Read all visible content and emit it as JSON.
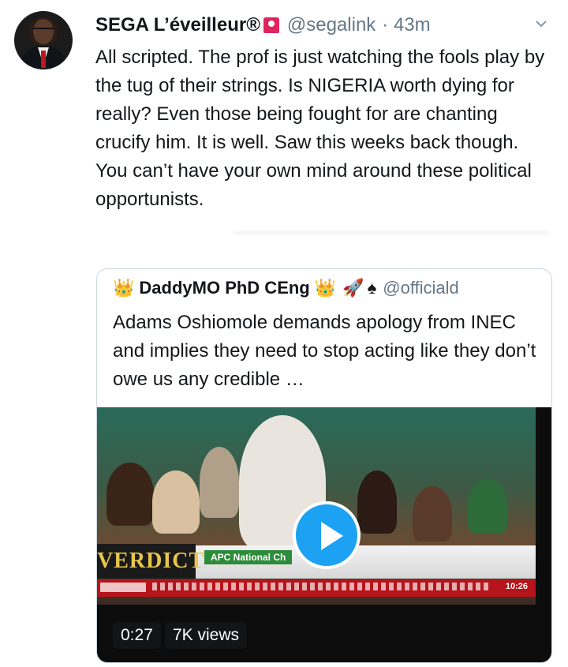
{
  "tweet": {
    "author_name": "SEGA L’éveilleur®",
    "author_handle": "@segalink",
    "timestamp": "· 43m",
    "text": "All scripted. The prof is just watching the fools play by the tug of their strings. Is NIGERIA worth dying for really? Even those being fought for are chanting crucify him. It is well. Saw this weeks back though. You can’t have your own mind around these political opportunists.",
    "siren_icon": "police-light-emoji",
    "menu_icon": "chevron-down-icon"
  },
  "quoted": {
    "crown_left": "👑",
    "author_name": "DaddyMO PhD CEng",
    "crown_right": "👑",
    "rocket": "🚀",
    "spade": "♠",
    "author_handle": "@officiald",
    "text": "Adams Oshiomole demands apology from INEC and implies they need to stop acting like they don’t owe us any credible …",
    "video": {
      "duration": "0:27",
      "views": "7K views",
      "banner_logo": "VERDICT",
      "banner_tag": "APC National Ch",
      "clock": "10:26",
      "accent_color": "#1da1f2"
    }
  }
}
